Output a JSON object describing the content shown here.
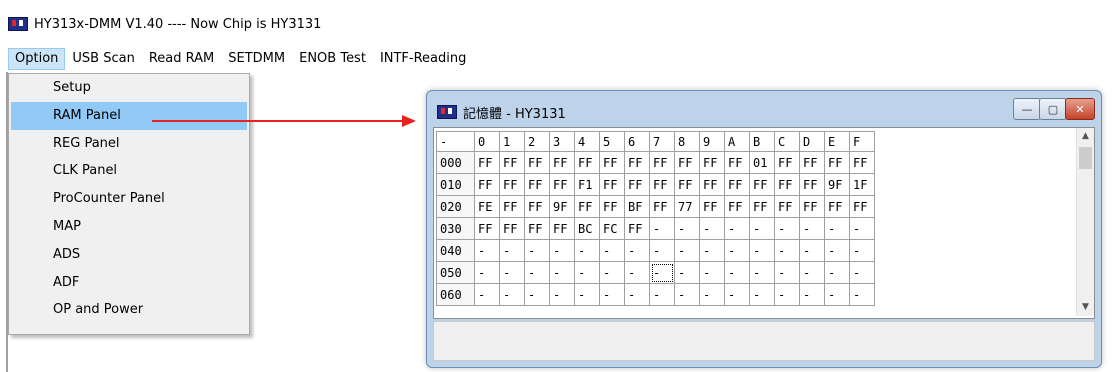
{
  "app": {
    "title": "HY313x-DMM V1.40 ---- Now Chip is  HY3131"
  },
  "menu": [
    "Option",
    "USB Scan",
    "Read RAM",
    "SETDMM",
    "ENOB Test",
    "INTF-Reading"
  ],
  "option_menu": {
    "items": [
      "Setup",
      "RAM Panel",
      "REG Panel",
      "CLK Panel",
      "ProCounter Panel",
      "MAP",
      "ADS",
      "ADF",
      "OP and Power"
    ],
    "selected": "RAM Panel"
  },
  "annotation": {
    "arrow_color": "#e8231f"
  },
  "ram_window": {
    "title": "記憶體 - HY3131",
    "buttons": {
      "minimize": "—",
      "maximize": "▢",
      "close": "✕"
    },
    "corner": "-",
    "col_headers": [
      "0",
      "1",
      "2",
      "3",
      "4",
      "5",
      "6",
      "7",
      "8",
      "9",
      "A",
      "B",
      "C",
      "D",
      "E",
      "F"
    ],
    "rows": [
      {
        "addr": "000",
        "cells": [
          "FF",
          "FF",
          "FF",
          "FF",
          "FF",
          "FF",
          "FF",
          "FF",
          "FF",
          "FF",
          "FF",
          "01",
          "FF",
          "FF",
          "FF",
          "FF"
        ]
      },
      {
        "addr": "010",
        "cells": [
          "FF",
          "FF",
          "FF",
          "FF",
          "F1",
          "FF",
          "FF",
          "FF",
          "FF",
          "FF",
          "FF",
          "FF",
          "FF",
          "FF",
          "9F",
          "1F"
        ]
      },
      {
        "addr": "020",
        "cells": [
          "FE",
          "FF",
          "FF",
          "9F",
          "FF",
          "FF",
          "BF",
          "FF",
          "77",
          "FF",
          "FF",
          "FF",
          "FF",
          "FF",
          "FF",
          "FF"
        ]
      },
      {
        "addr": "030",
        "cells": [
          "FF",
          "FF",
          "FF",
          "FF",
          "BC",
          "FC",
          "FF",
          "-",
          "-",
          "-",
          "-",
          "-",
          "-",
          "-",
          "-",
          "-"
        ]
      },
      {
        "addr": "040",
        "cells": [
          "-",
          "-",
          "-",
          "-",
          "-",
          "-",
          "-",
          "-",
          "-",
          "-",
          "-",
          "-",
          "-",
          "-",
          "-",
          "-"
        ]
      },
      {
        "addr": "050",
        "cells": [
          "-",
          "-",
          "-",
          "-",
          "-",
          "-",
          "-",
          "-",
          "-",
          "-",
          "-",
          "-",
          "-",
          "-",
          "-",
          "-"
        ]
      },
      {
        "addr": "060",
        "cells": [
          "-",
          "-",
          "-",
          "-",
          "-",
          "-",
          "-",
          "-",
          "-",
          "-",
          "-",
          "-",
          "-",
          "-",
          "-",
          "-"
        ]
      }
    ],
    "focused_cell": {
      "row": 5,
      "col": 7
    },
    "scroll": {
      "up": "▲",
      "down": "▼"
    }
  }
}
